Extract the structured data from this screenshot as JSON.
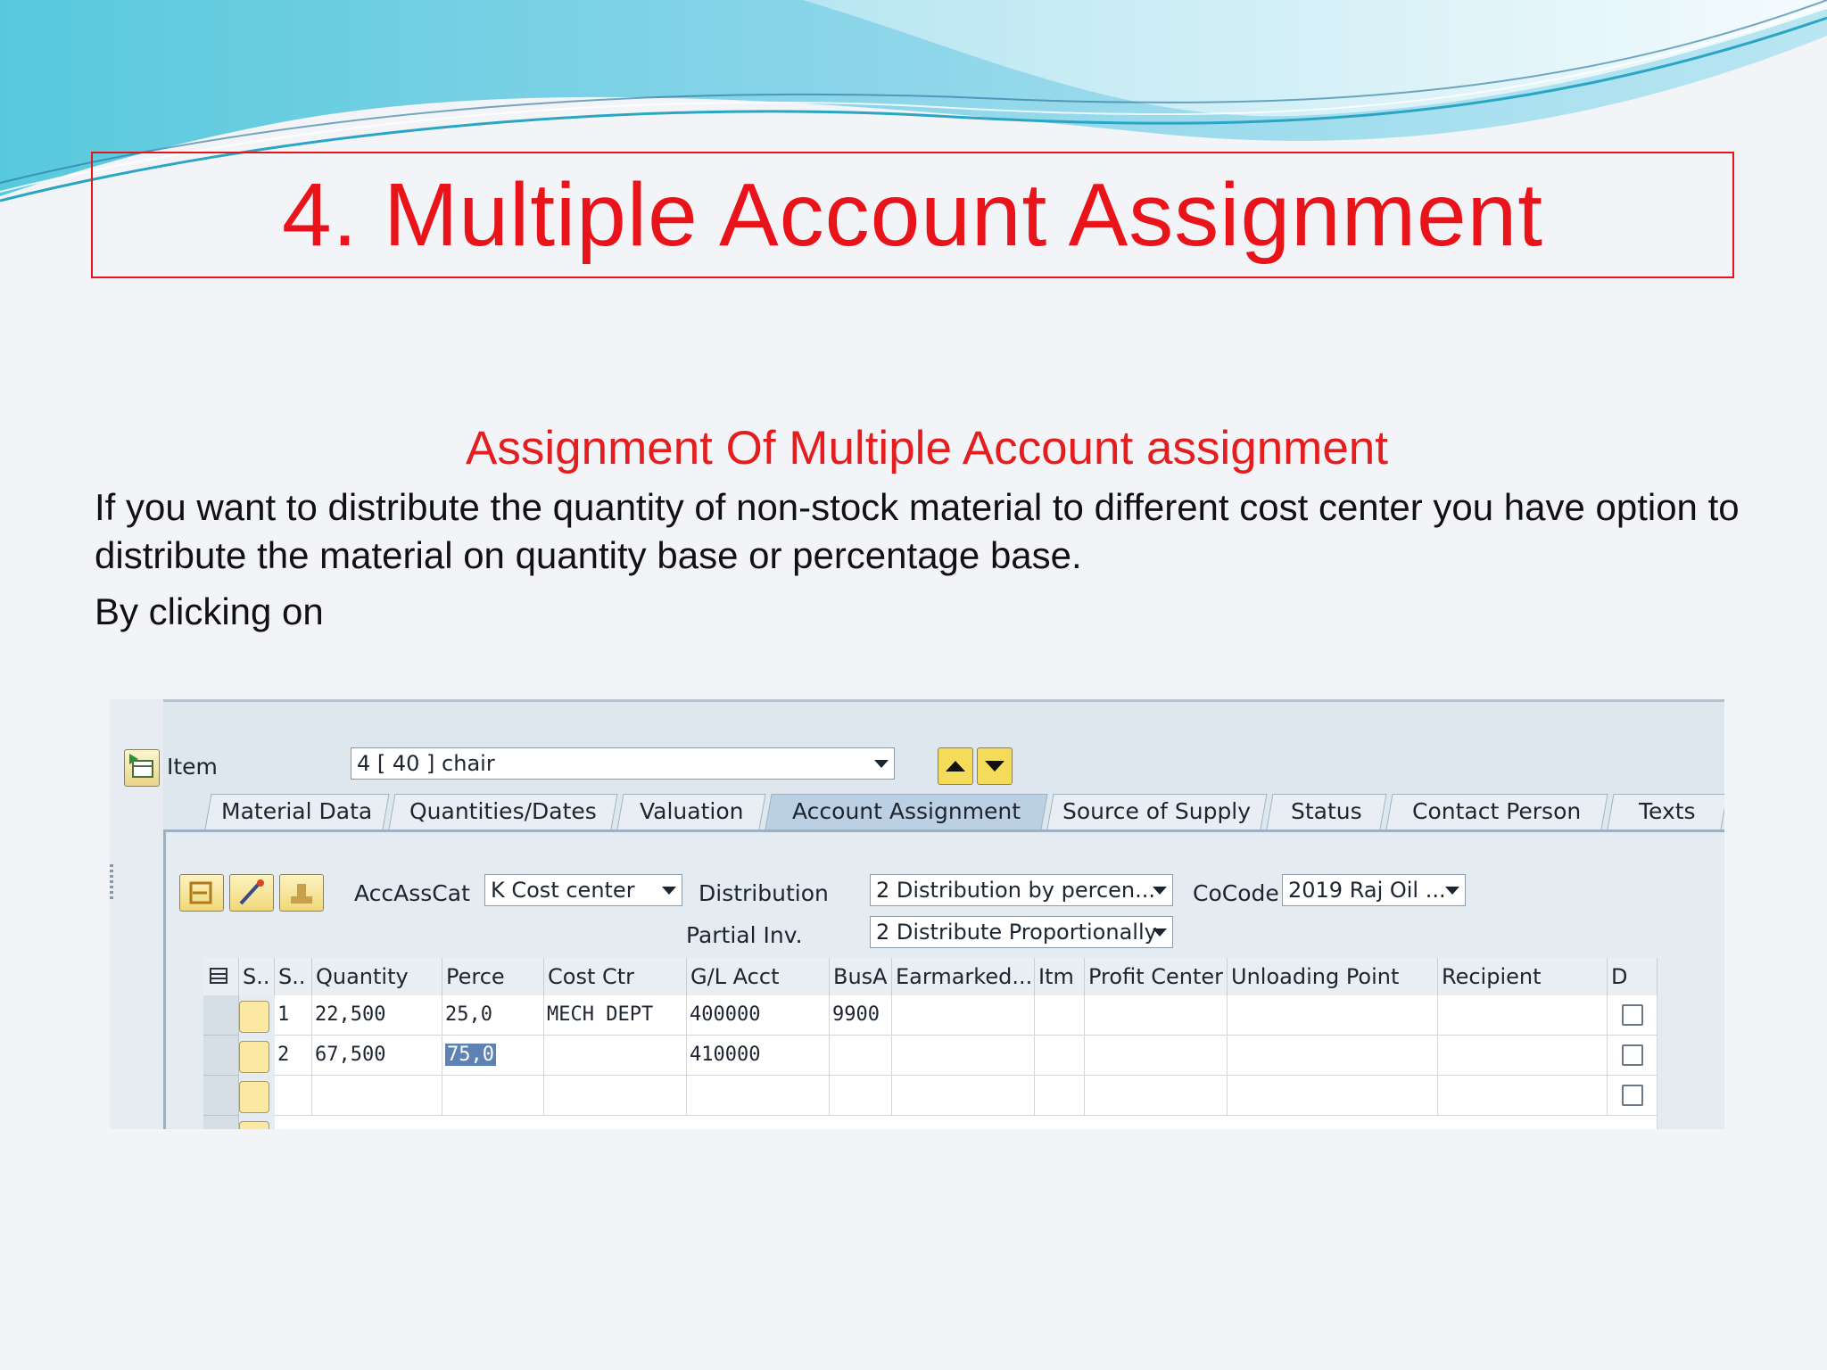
{
  "slide": {
    "title": "4. Multiple Account Assignment",
    "subtitle": "Assignment Of Multiple Account assignment",
    "paragraph": "If you want to distribute the quantity of non-stock material to different cost center you have option to distribute the material on quantity base or percentage base.",
    "paragraph2": "By clicking on"
  },
  "colors": {
    "title_red": "#e8141a",
    "wave_cyan": "#7fd3e3",
    "sap_blue": "#bcd0e4",
    "button_yellow": "#f0d87a"
  },
  "sap": {
    "item_label": "Item",
    "item_value": "4 [ 40 ] chair",
    "tabs": [
      "Material Data",
      "Quantities/Dates",
      "Valuation",
      "Account Assignment",
      "Source of Supply",
      "Status",
      "Contact Person",
      "Texts"
    ],
    "active_tab": "Account Assignment",
    "accasscat_label": "AccAssCat",
    "accasscat_value": "K Cost center",
    "distribution_label": "Distribution",
    "distribution_value": "2 Distribution by percen...",
    "partial_label": "Partial Inv.",
    "partial_value": "2 Distribute Proportionally",
    "cocode_label": "CoCode",
    "cocode_value": "2019 Raj Oil ...",
    "icons": [
      "item-detail-icon",
      "arrow-up-icon",
      "arrow-down-icon",
      "reset-icon",
      "wand-icon",
      "stamp-icon",
      "table-settings-icon"
    ],
    "columns": [
      "S..",
      "S..",
      "Quantity",
      "Perce",
      "Cost Ctr",
      "G/L Acct",
      "BusA",
      "Earmarked...",
      "Itm",
      "Profit Center",
      "Unloading Point",
      "Recipient",
      "D"
    ],
    "rows": [
      {
        "sno": "1",
        "quantity": "22,500",
        "percent": "25,0",
        "cost_ctr": "MECH DEPT",
        "gl_acct": "400000",
        "busa": "9900"
      },
      {
        "sno": "2",
        "quantity": "67,500",
        "percent": "75,0",
        "cost_ctr": "",
        "gl_acct": "410000",
        "busa": ""
      },
      {
        "sno": "",
        "quantity": "",
        "percent": "",
        "cost_ctr": "",
        "gl_acct": "",
        "busa": ""
      }
    ]
  }
}
